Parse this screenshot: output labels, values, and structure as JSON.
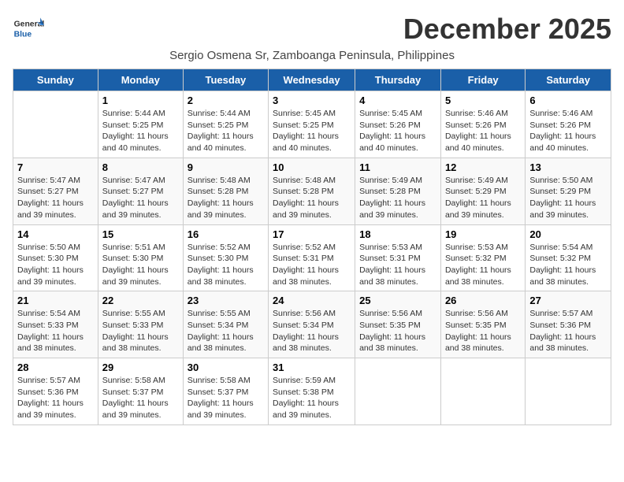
{
  "header": {
    "logo_general": "General",
    "logo_blue": "Blue",
    "month_title": "December 2025",
    "subtitle": "Sergio Osmena Sr, Zamboanga Peninsula, Philippines"
  },
  "days_of_week": [
    "Sunday",
    "Monday",
    "Tuesday",
    "Wednesday",
    "Thursday",
    "Friday",
    "Saturday"
  ],
  "weeks": [
    [
      {
        "day": "",
        "text": ""
      },
      {
        "day": "1",
        "text": "Sunrise: 5:44 AM\nSunset: 5:25 PM\nDaylight: 11 hours\nand 40 minutes."
      },
      {
        "day": "2",
        "text": "Sunrise: 5:44 AM\nSunset: 5:25 PM\nDaylight: 11 hours\nand 40 minutes."
      },
      {
        "day": "3",
        "text": "Sunrise: 5:45 AM\nSunset: 5:25 PM\nDaylight: 11 hours\nand 40 minutes."
      },
      {
        "day": "4",
        "text": "Sunrise: 5:45 AM\nSunset: 5:26 PM\nDaylight: 11 hours\nand 40 minutes."
      },
      {
        "day": "5",
        "text": "Sunrise: 5:46 AM\nSunset: 5:26 PM\nDaylight: 11 hours\nand 40 minutes."
      },
      {
        "day": "6",
        "text": "Sunrise: 5:46 AM\nSunset: 5:26 PM\nDaylight: 11 hours\nand 40 minutes."
      }
    ],
    [
      {
        "day": "7",
        "text": "Sunrise: 5:47 AM\nSunset: 5:27 PM\nDaylight: 11 hours\nand 39 minutes."
      },
      {
        "day": "8",
        "text": "Sunrise: 5:47 AM\nSunset: 5:27 PM\nDaylight: 11 hours\nand 39 minutes."
      },
      {
        "day": "9",
        "text": "Sunrise: 5:48 AM\nSunset: 5:28 PM\nDaylight: 11 hours\nand 39 minutes."
      },
      {
        "day": "10",
        "text": "Sunrise: 5:48 AM\nSunset: 5:28 PM\nDaylight: 11 hours\nand 39 minutes."
      },
      {
        "day": "11",
        "text": "Sunrise: 5:49 AM\nSunset: 5:28 PM\nDaylight: 11 hours\nand 39 minutes."
      },
      {
        "day": "12",
        "text": "Sunrise: 5:49 AM\nSunset: 5:29 PM\nDaylight: 11 hours\nand 39 minutes."
      },
      {
        "day": "13",
        "text": "Sunrise: 5:50 AM\nSunset: 5:29 PM\nDaylight: 11 hours\nand 39 minutes."
      }
    ],
    [
      {
        "day": "14",
        "text": "Sunrise: 5:50 AM\nSunset: 5:30 PM\nDaylight: 11 hours\nand 39 minutes."
      },
      {
        "day": "15",
        "text": "Sunrise: 5:51 AM\nSunset: 5:30 PM\nDaylight: 11 hours\nand 39 minutes."
      },
      {
        "day": "16",
        "text": "Sunrise: 5:52 AM\nSunset: 5:30 PM\nDaylight: 11 hours\nand 38 minutes."
      },
      {
        "day": "17",
        "text": "Sunrise: 5:52 AM\nSunset: 5:31 PM\nDaylight: 11 hours\nand 38 minutes."
      },
      {
        "day": "18",
        "text": "Sunrise: 5:53 AM\nSunset: 5:31 PM\nDaylight: 11 hours\nand 38 minutes."
      },
      {
        "day": "19",
        "text": "Sunrise: 5:53 AM\nSunset: 5:32 PM\nDaylight: 11 hours\nand 38 minutes."
      },
      {
        "day": "20",
        "text": "Sunrise: 5:54 AM\nSunset: 5:32 PM\nDaylight: 11 hours\nand 38 minutes."
      }
    ],
    [
      {
        "day": "21",
        "text": "Sunrise: 5:54 AM\nSunset: 5:33 PM\nDaylight: 11 hours\nand 38 minutes."
      },
      {
        "day": "22",
        "text": "Sunrise: 5:55 AM\nSunset: 5:33 PM\nDaylight: 11 hours\nand 38 minutes."
      },
      {
        "day": "23",
        "text": "Sunrise: 5:55 AM\nSunset: 5:34 PM\nDaylight: 11 hours\nand 38 minutes."
      },
      {
        "day": "24",
        "text": "Sunrise: 5:56 AM\nSunset: 5:34 PM\nDaylight: 11 hours\nand 38 minutes."
      },
      {
        "day": "25",
        "text": "Sunrise: 5:56 AM\nSunset: 5:35 PM\nDaylight: 11 hours\nand 38 minutes."
      },
      {
        "day": "26",
        "text": "Sunrise: 5:56 AM\nSunset: 5:35 PM\nDaylight: 11 hours\nand 38 minutes."
      },
      {
        "day": "27",
        "text": "Sunrise: 5:57 AM\nSunset: 5:36 PM\nDaylight: 11 hours\nand 38 minutes."
      }
    ],
    [
      {
        "day": "28",
        "text": "Sunrise: 5:57 AM\nSunset: 5:36 PM\nDaylight: 11 hours\nand 39 minutes."
      },
      {
        "day": "29",
        "text": "Sunrise: 5:58 AM\nSunset: 5:37 PM\nDaylight: 11 hours\nand 39 minutes."
      },
      {
        "day": "30",
        "text": "Sunrise: 5:58 AM\nSunset: 5:37 PM\nDaylight: 11 hours\nand 39 minutes."
      },
      {
        "day": "31",
        "text": "Sunrise: 5:59 AM\nSunset: 5:38 PM\nDaylight: 11 hours\nand 39 minutes."
      },
      {
        "day": "",
        "text": ""
      },
      {
        "day": "",
        "text": ""
      },
      {
        "day": "",
        "text": ""
      }
    ]
  ]
}
